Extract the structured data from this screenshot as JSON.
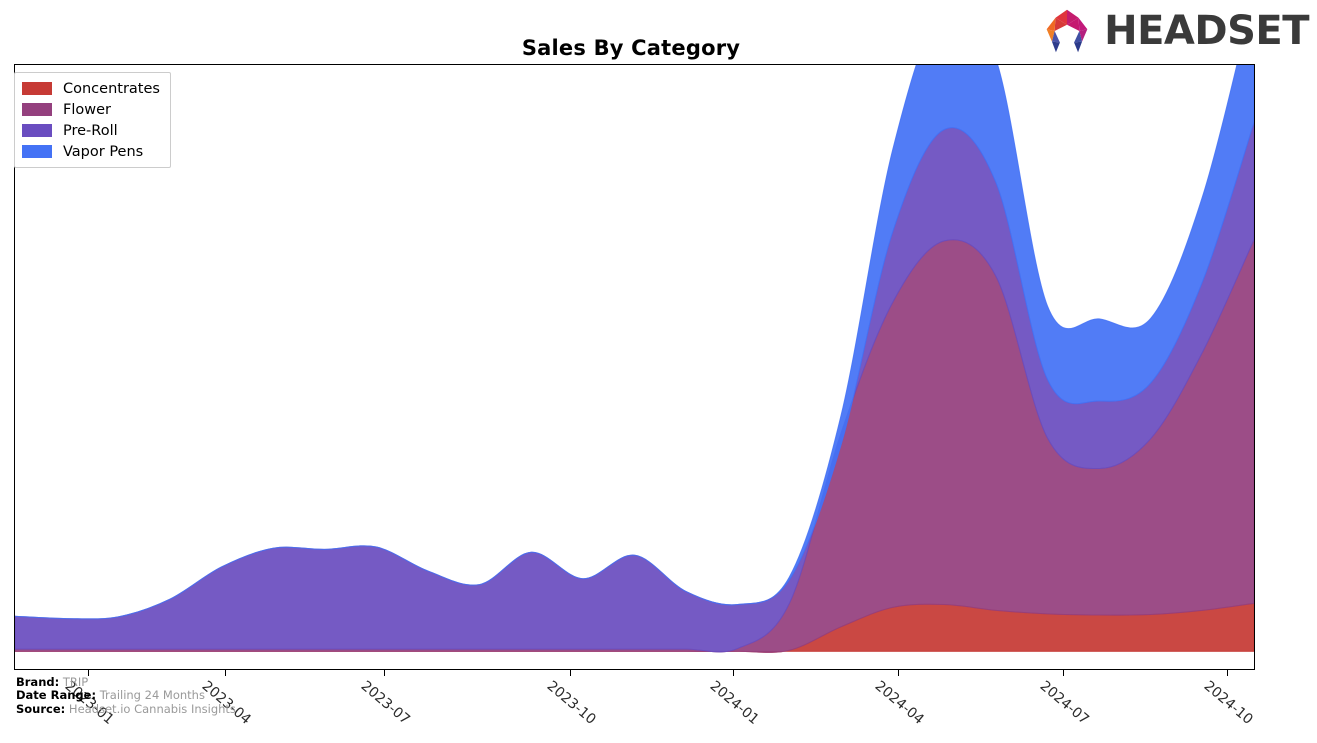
{
  "header": {
    "title": "Sales By Category",
    "logo_text": "HEADSET",
    "logo_icon": "headset-arch-logo"
  },
  "legend": {
    "position": "top-left",
    "items": [
      {
        "label": "Concentrates",
        "color": "#c63a35"
      },
      {
        "label": "Flower",
        "color": "#94407e"
      },
      {
        "label": "Pre-Roll",
        "color": "#6a4dc0"
      },
      {
        "label": "Vapor Pens",
        "color": "#4472f5"
      }
    ]
  },
  "footer": {
    "brand_key": "Brand:",
    "brand_value": "TRIP",
    "date_range_key": "Date Range:",
    "date_range_value": "Trailing 24 Months",
    "source_key": "Source:",
    "source_value": "Headset.io Cannabis Insights"
  },
  "chart_data": {
    "type": "area",
    "stacked": true,
    "title": "Sales By Category",
    "xlabel": "",
    "ylabel": "",
    "grid": false,
    "legend_position": "upper left",
    "axis_tick_rotation": -40,
    "xticks": [
      "2023-01",
      "2023-04",
      "2023-07",
      "2023-10",
      "2024-01",
      "2024-04",
      "2024-07",
      "2024-10"
    ],
    "xtick_pixels": [
      88,
      225,
      384,
      570,
      733,
      898,
      1063,
      1227
    ],
    "x": [
      "2022-11",
      "2022-12",
      "2023-01",
      "2023-02",
      "2023-03",
      "2023-04",
      "2023-05",
      "2023-06",
      "2023-07",
      "2023-08",
      "2023-09",
      "2023-10",
      "2023-11",
      "2023-12",
      "2024-01",
      "2024-02",
      "2024-03",
      "2024-04",
      "2024-05",
      "2024-06",
      "2024-07",
      "2024-08",
      "2024-09",
      "2024-10",
      "2024-11"
    ],
    "ylim": [
      -3,
      100
    ],
    "ylabel_visible": false,
    "series": [
      {
        "name": "Concentrates",
        "color": "#c63a35",
        "values": [
          0,
          0,
          0,
          0,
          0,
          0,
          0,
          0,
          0,
          0,
          0,
          0,
          0,
          0,
          0,
          0.2,
          4.2,
          7.5,
          8.0,
          7.0,
          6.4,
          6.2,
          6.3,
          7.0,
          8.2
        ]
      },
      {
        "name": "Flower",
        "color": "#94407e",
        "values": [
          0.4,
          0.4,
          0.4,
          0.4,
          0.4,
          0.4,
          0.4,
          0.4,
          0.4,
          0.4,
          0.4,
          0.4,
          0.4,
          0.4,
          0.5,
          8.0,
          33.0,
          52.0,
          62.0,
          57.0,
          30.0,
          25.0,
          30.0,
          44.0,
          62.0
        ]
      },
      {
        "name": "Pre-Roll",
        "color": "#6a4dc0",
        "values": [
          5.6,
          5.2,
          5.5,
          8.5,
          14.0,
          17.2,
          17.0,
          17.4,
          13.3,
          11.0,
          16.5,
          12.0,
          16.0,
          9.8,
          7.5,
          4.0,
          -2.0,
          12.0,
          19.0,
          16.0,
          10.0,
          11.5,
          9.5,
          12.0,
          20.0
        ]
      },
      {
        "name": "Vapor Pens",
        "color": "#4472f5",
        "values": [
          0,
          0,
          0,
          0,
          0,
          0,
          0,
          0,
          0,
          0,
          0,
          0,
          0,
          0,
          0,
          0.5,
          5.0,
          14.0,
          21.0,
          21.0,
          12.5,
          14.0,
          11.0,
          14.5,
          22.0
        ]
      }
    ]
  }
}
